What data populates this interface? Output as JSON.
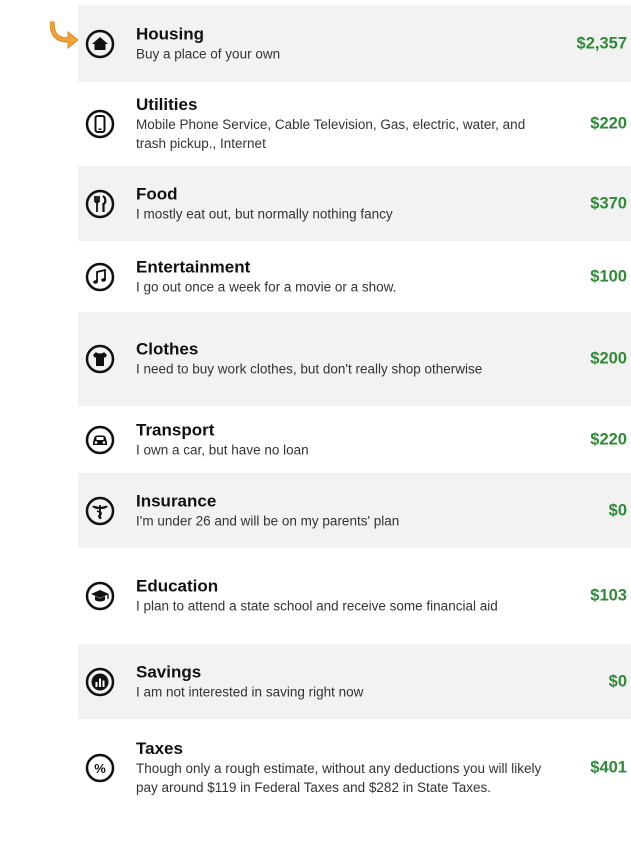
{
  "pointer": {
    "icon": "curved-arrow-icon",
    "color": "#f0a43a"
  },
  "items": [
    {
      "icon": "house-icon",
      "title": "Housing",
      "description": "Buy a place of your own",
      "amount": "$2,357"
    },
    {
      "icon": "mobile-phone-icon",
      "title": "Utilities",
      "description": "Mobile Phone Service, Cable Television, Gas, electric, water, and trash pickup., Internet",
      "amount": "$220"
    },
    {
      "icon": "fork-knife-icon",
      "title": "Food",
      "description": "I mostly eat out, but normally nothing fancy",
      "amount": "$370"
    },
    {
      "icon": "music-note-icon",
      "title": "Entertainment",
      "description": "I go out once a week for a movie or a show.",
      "amount": "$100"
    },
    {
      "icon": "shirt-icon",
      "title": "Clothes",
      "description": "I need to buy work clothes, but don't really shop otherwise",
      "amount": "$200"
    },
    {
      "icon": "car-icon",
      "title": "Transport",
      "description": "I own a car, but have no loan",
      "amount": "$220"
    },
    {
      "icon": "caduceus-icon",
      "title": "Insurance",
      "description": "I'm under 26 and will be on my parents' plan",
      "amount": "$0"
    },
    {
      "icon": "graduation-cap-icon",
      "title": "Education",
      "description": "I plan to attend a state school and receive some financial aid",
      "amount": "$103"
    },
    {
      "icon": "bar-chart-icon",
      "title": "Savings",
      "description": "I am not interested in saving right now",
      "amount": "$0"
    },
    {
      "icon": "percent-icon",
      "title": "Taxes",
      "description": "Though only a rough estimate, without any deductions you will likely pay around $119 in Federal Taxes and $282 in State Taxes.",
      "amount": "$401"
    }
  ],
  "colors": {
    "amount": "#2f8a38",
    "row_shade": "#f2f2f2",
    "pointer": "#f0a43a"
  }
}
